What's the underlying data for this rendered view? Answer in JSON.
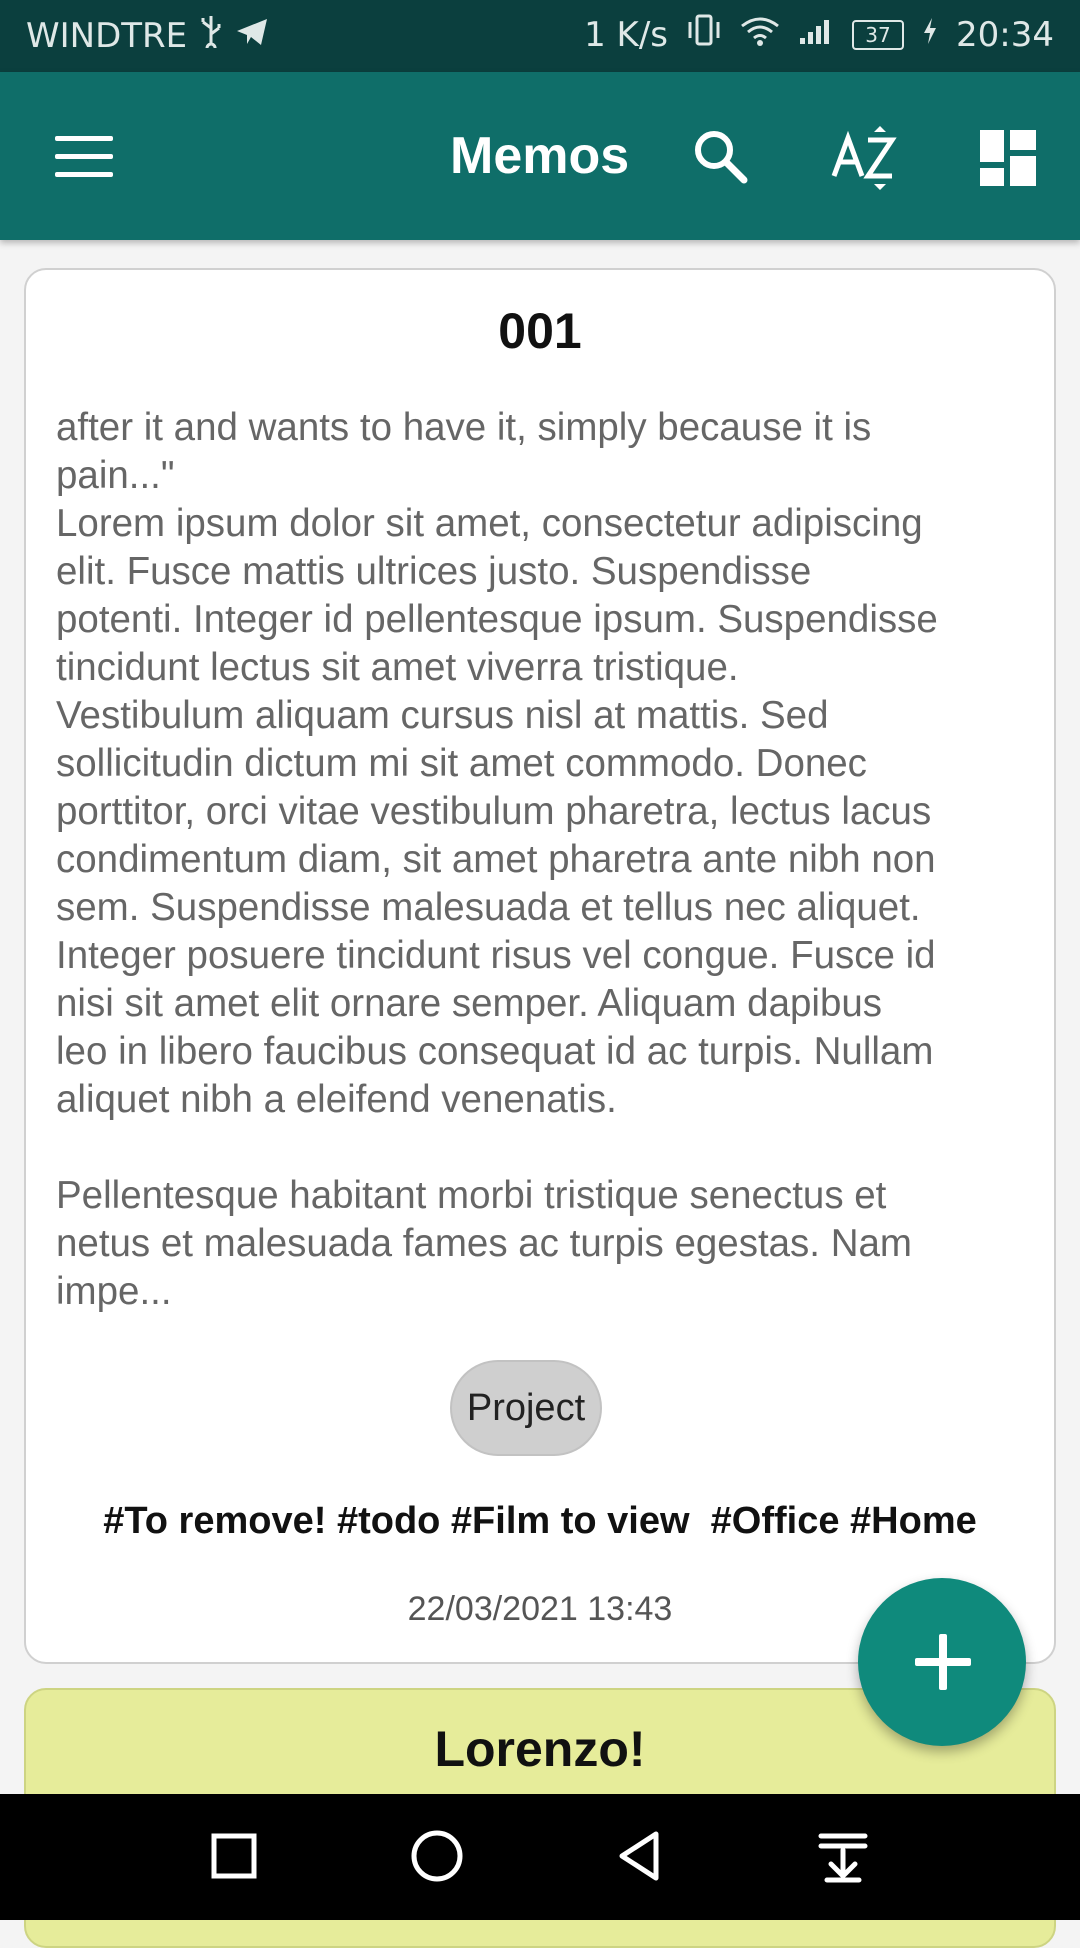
{
  "status_bar": {
    "carrier": "WINDTRE",
    "speed": "1 K/s",
    "battery": "37",
    "time": "20:34"
  },
  "app_bar": {
    "title": "Memos",
    "icons": [
      "menu-icon",
      "search-icon",
      "sort-az-icon",
      "dashboard-icon"
    ]
  },
  "memo": {
    "title": "001",
    "body": "after it and wants to have it, simply because it is\npain...\"\nLorem ipsum dolor sit amet, consectetur adipiscing\nelit. Fusce mattis ultrices justo. Suspendisse\npotenti. Integer id pellentesque ipsum. Suspendisse\ntincidunt lectus sit amet viverra tristique.\nVestibulum aliquam cursus nisl at mattis. Sed\nsollicitudin dictum mi sit amet commodo. Donec\nporttitor, orci vitae vestibulum pharetra, lectus lacus\ncondimentum diam, sit amet pharetra ante nibh non\nsem. Suspendisse malesuada et tellus nec aliquet.\nInteger posuere tincidunt risus vel congue. Fusce id\nnisi sit amet elit ornare semper. Aliquam dapibus\nleo in libero faucibus consequat id ac turpis. Nullam\naliquet nibh a eleifend venenatis.\n\nPellentesque habitant morbi tristique senectus et\nnetus et malesuada fames ac turpis egestas. Nam\nimpe...",
    "category": "Project",
    "tags": "#To remove! #todo #Film to view  #Office #Home",
    "date": "22/03/2021 13:43"
  },
  "memo2": {
    "title": "Lorenzo!"
  },
  "colors": {
    "status_bar": "#0b3f3e",
    "app_bar": "#0f6e69",
    "fab": "#0f8a7c",
    "card2_bg": "#e6ec9a"
  },
  "fab": {
    "icon": "plus-icon"
  },
  "nav_bar": {
    "icons": [
      "recent-apps-icon",
      "home-icon",
      "back-icon",
      "notifications-pull-icon"
    ]
  }
}
